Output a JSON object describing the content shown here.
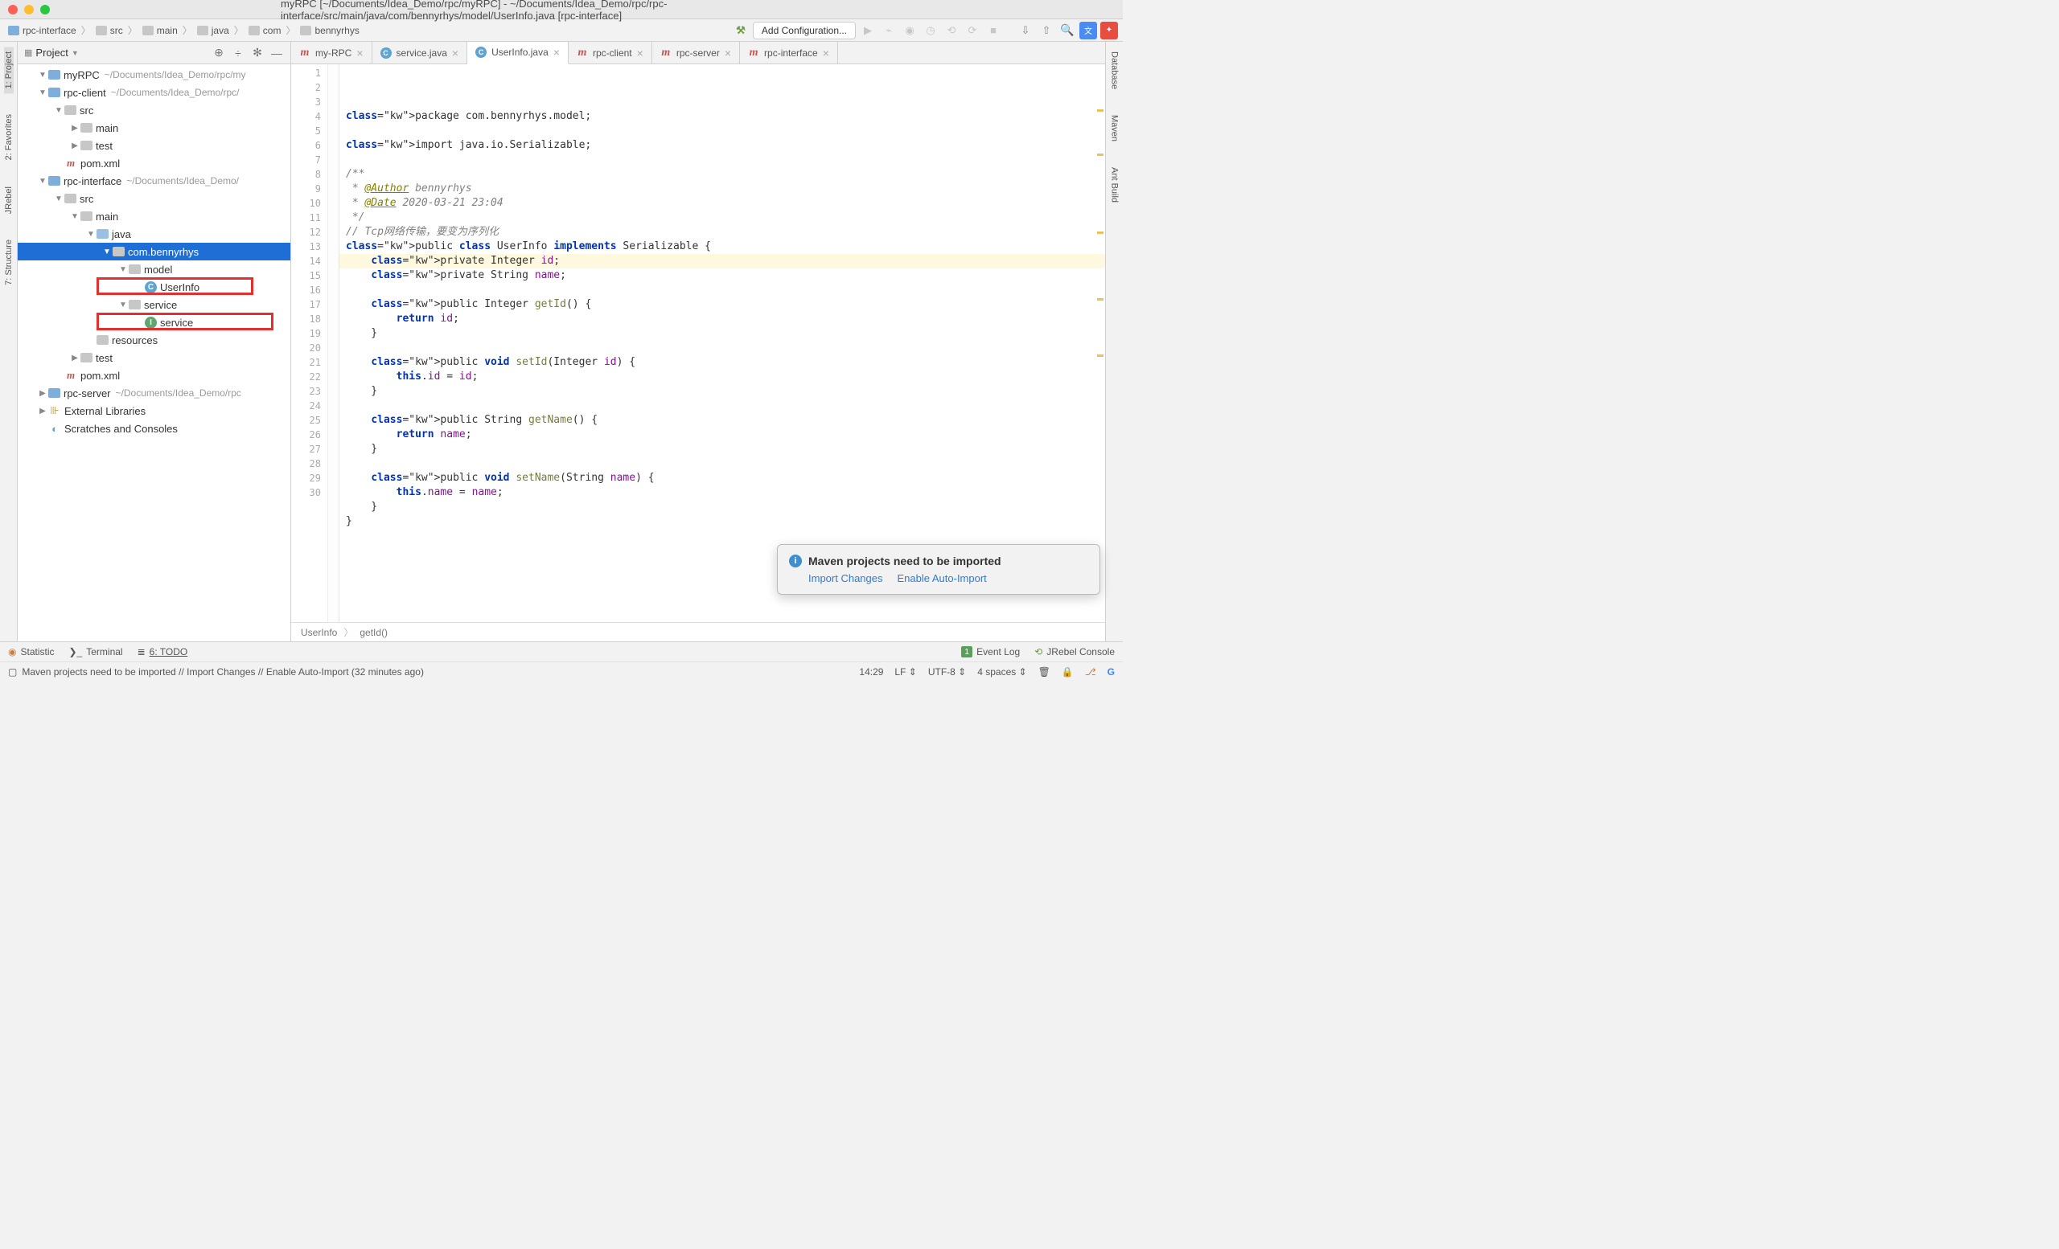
{
  "window": {
    "title": "myRPC [~/Documents/Idea_Demo/rpc/myRPC] - ~/Documents/Idea_Demo/rpc/rpc-interface/src/main/java/com/bennyrhys/model/UserInfo.java [rpc-interface]"
  },
  "breadcrumb": [
    "rpc-interface",
    "src",
    "main",
    "java",
    "com",
    "bennyrhys"
  ],
  "toolbar": {
    "add_config": "Add Configuration..."
  },
  "left_strip": {
    "project": "1: Project",
    "favorites": "2: Favorites",
    "jrebel": "JRebel",
    "structure": "7: Structure"
  },
  "right_strip": {
    "database": "Database",
    "maven": "Maven",
    "ant": "Ant Build"
  },
  "project_panel": {
    "title": "Project",
    "tree": [
      {
        "lvl": 0,
        "exp": "▼",
        "ic": "folder blue",
        "label": "myRPC",
        "path": "~/Documents/Idea_Demo/rpc/my"
      },
      {
        "lvl": 0,
        "exp": "▼",
        "ic": "folder blue",
        "label": "rpc-client",
        "path": "~/Documents/Idea_Demo/rpc/"
      },
      {
        "lvl": 1,
        "exp": "▼",
        "ic": "folder",
        "label": "src"
      },
      {
        "lvl": 2,
        "exp": "▶",
        "ic": "folder",
        "label": "main"
      },
      {
        "lvl": 2,
        "exp": "▶",
        "ic": "folder",
        "label": "test"
      },
      {
        "lvl": 1,
        "exp": "",
        "ic": "maven",
        "label": "pom.xml"
      },
      {
        "lvl": 0,
        "exp": "▼",
        "ic": "folder blue",
        "label": "rpc-interface",
        "path": "~/Documents/Idea_Demo/"
      },
      {
        "lvl": 1,
        "exp": "▼",
        "ic": "folder",
        "label": "src"
      },
      {
        "lvl": 2,
        "exp": "▼",
        "ic": "folder",
        "label": "main"
      },
      {
        "lvl": 3,
        "exp": "▼",
        "ic": "folder src",
        "label": "java"
      },
      {
        "lvl": 4,
        "exp": "▼",
        "ic": "folder",
        "label": "com.bennyrhys",
        "selected": true
      },
      {
        "lvl": 5,
        "exp": "▼",
        "ic": "folder",
        "label": "model"
      },
      {
        "lvl": 6,
        "exp": "",
        "ic": "class",
        "label": "UserInfo",
        "boxed": true
      },
      {
        "lvl": 5,
        "exp": "▼",
        "ic": "folder",
        "label": "service"
      },
      {
        "lvl": 6,
        "exp": "",
        "ic": "interface",
        "label": "service",
        "boxed": true
      },
      {
        "lvl": 3,
        "exp": "",
        "ic": "folder",
        "label": "resources"
      },
      {
        "lvl": 2,
        "exp": "▶",
        "ic": "folder",
        "label": "test"
      },
      {
        "lvl": 1,
        "exp": "",
        "ic": "maven",
        "label": "pom.xml"
      },
      {
        "lvl": 0,
        "exp": "▶",
        "ic": "folder blue",
        "label": "rpc-server",
        "path": "~/Documents/Idea_Demo/rpc"
      },
      {
        "lvl": 0,
        "exp": "▶",
        "ic": "lib",
        "label": "External Libraries"
      },
      {
        "lvl": 0,
        "exp": "",
        "ic": "scratch",
        "label": "Scratches and Consoles"
      }
    ]
  },
  "tabs": [
    {
      "ic": "m",
      "label": "my-RPC"
    },
    {
      "ic": "c",
      "label": "service.java"
    },
    {
      "ic": "c",
      "label": "UserInfo.java",
      "active": true
    },
    {
      "ic": "m",
      "label": "rpc-client"
    },
    {
      "ic": "m",
      "label": "rpc-server"
    },
    {
      "ic": "m",
      "label": "rpc-interface"
    }
  ],
  "code": {
    "lines": [
      "package com.bennyrhys.model;",
      "",
      "import java.io.Serializable;",
      "",
      "/**",
      " * @Author bennyrhys",
      " * @Date 2020-03-21 23:04",
      " */",
      "// Tcp网络传输，要变为序列化",
      "public class UserInfo implements Serializable {",
      "    private Integer id;",
      "    private String name;",
      "",
      "    public Integer getId() {",
      "        return id;",
      "    }",
      "",
      "    public void setId(Integer id) {",
      "        this.id = id;",
      "    }",
      "",
      "    public String getName() {",
      "        return name;",
      "    }",
      "",
      "    public void setName(String name) {",
      "        this.name = name;",
      "    }",
      "}",
      ""
    ],
    "highlight_line": 14
  },
  "editor_crumb": [
    "UserInfo",
    "getId()"
  ],
  "popup": {
    "title": "Maven projects need to be imported",
    "link1": "Import Changes",
    "link2": "Enable Auto-Import"
  },
  "bottom_bar": {
    "statistic": "Statistic",
    "terminal": "Terminal",
    "todo": "6: TODO",
    "event_log": "Event Log",
    "jrebel": "JRebel Console"
  },
  "status": {
    "msg": "Maven projects need to be imported // Import Changes // Enable Auto-Import (32 minutes ago)",
    "pos": "14:29",
    "le": "LF",
    "enc": "UTF-8",
    "indent": "4 spaces"
  }
}
